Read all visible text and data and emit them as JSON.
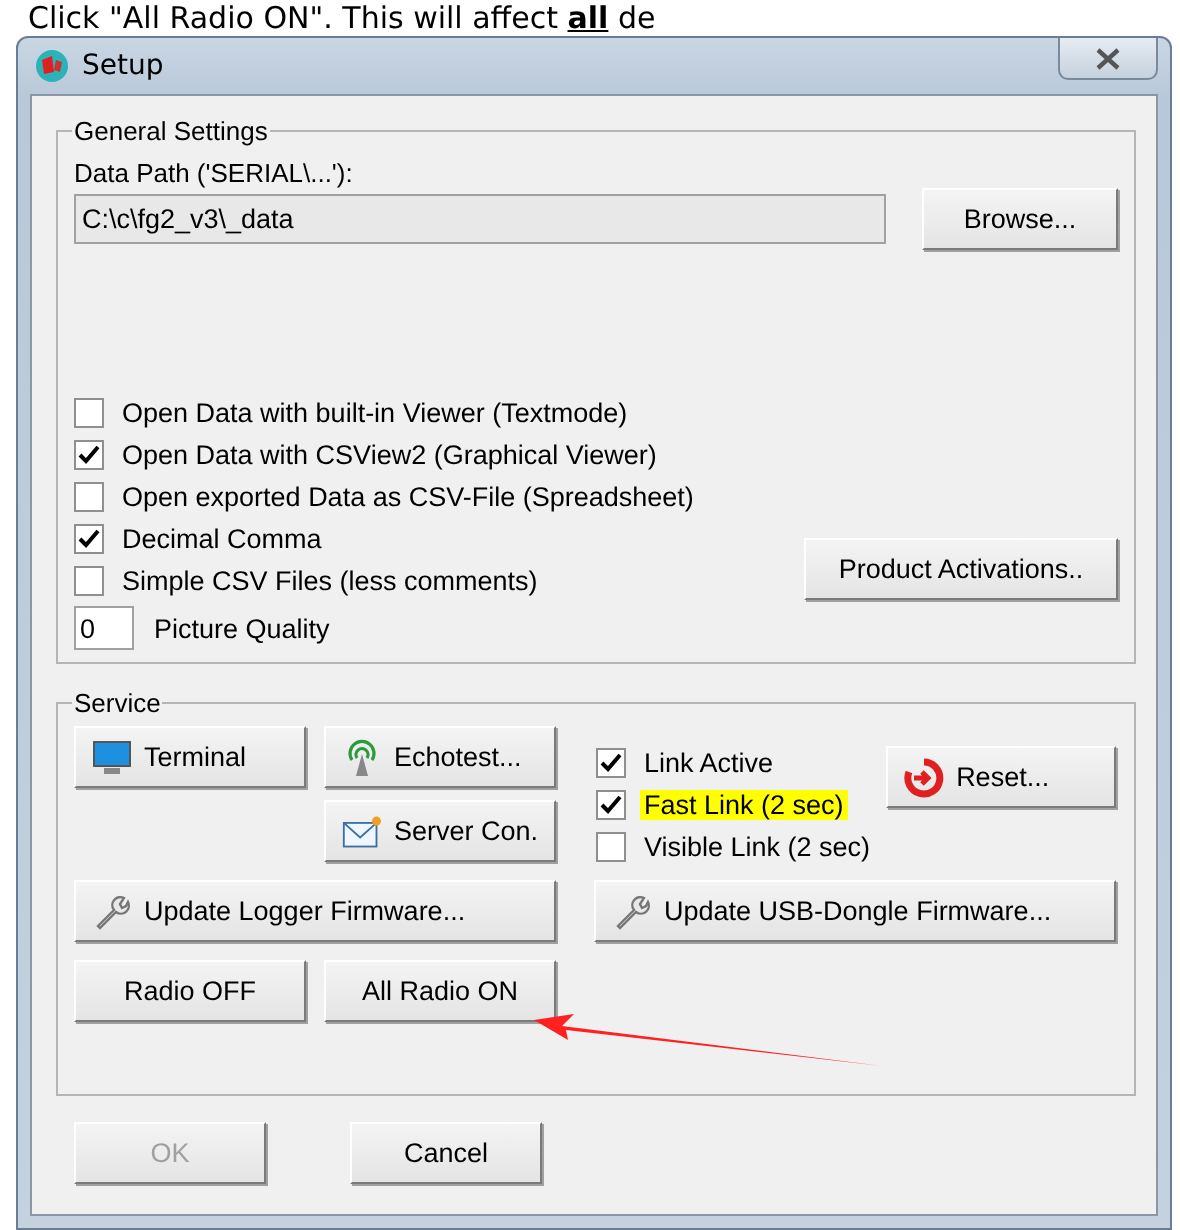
{
  "caption": "Click \"All Radio ON\". This will affect **all** de",
  "window": {
    "title": "Setup"
  },
  "general": {
    "title": "General Settings",
    "data_path_label": "Data Path ('SERIAL\\...'):",
    "data_path_value": "C:\\c\\fg2_v3\\_data",
    "browse_button": "Browse...",
    "options": [
      {
        "label": "Open Data with built-in Viewer (Textmode)",
        "checked": false
      },
      {
        "label": "Open Data with CSView2 (Graphical Viewer)",
        "checked": true
      },
      {
        "label": "Open exported Data as CSV-File (Spreadsheet)",
        "checked": false
      },
      {
        "label": "Decimal Comma",
        "checked": true
      },
      {
        "label": "Simple CSV Files (less comments)",
        "checked": false
      }
    ],
    "product_button": "Product Activations..",
    "picture_quality_value": "0",
    "picture_quality_label": "Picture Quality"
  },
  "service": {
    "title": "Service",
    "terminal_button": "Terminal",
    "echotest_button": "Echotest...",
    "server_button": "Server Con.",
    "links": [
      {
        "label": "Link Active",
        "checked": true,
        "highlighted": false
      },
      {
        "label": "Fast Link (2 sec)",
        "checked": true,
        "highlighted": true
      },
      {
        "label": "Visible Link (2 sec)",
        "checked": false,
        "highlighted": false
      }
    ],
    "reset_button": "Reset...",
    "logger_button": "Update Logger Firmware...",
    "dongle_button": "Update USB-Dongle Firmware...",
    "radio_off_button": "Radio OFF",
    "radio_on_button": "All Radio ON"
  },
  "buttons": [
    {
      "label": "OK",
      "disabled": true
    },
    {
      "label": "Cancel",
      "disabled": false
    }
  ]
}
